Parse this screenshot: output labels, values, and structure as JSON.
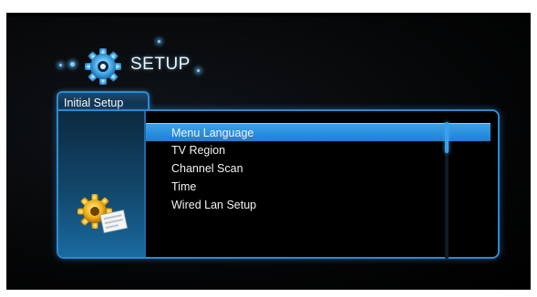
{
  "header": {
    "title": "SETUP",
    "icon": "gear-icon"
  },
  "tabs": [
    {
      "label": "Initial Setup",
      "active": true
    }
  ],
  "menu": {
    "items": [
      {
        "label": "Menu Language",
        "selected": true
      },
      {
        "label": "TV Region",
        "selected": false
      },
      {
        "label": "Channel Scan",
        "selected": false
      },
      {
        "label": "Time",
        "selected": false
      },
      {
        "label": "Wired Lan Setup",
        "selected": false
      }
    ]
  },
  "colors": {
    "accent": "#2a8ad0",
    "selection": "#2f93e0",
    "background": "#000000",
    "text": "#f2f2f2"
  }
}
